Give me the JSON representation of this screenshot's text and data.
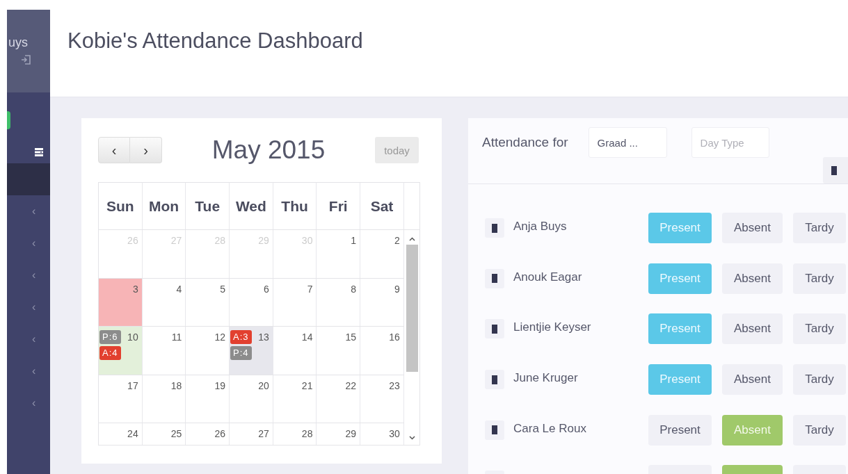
{
  "sidebar": {
    "user_name": "uys",
    "items": [
      {
        "kind": "badge"
      },
      {
        "kind": "menu"
      },
      {
        "kind": "nav",
        "selected": true
      },
      {
        "kind": "nav",
        "label": "‹",
        "selected": false
      },
      {
        "kind": "nav",
        "label": "‹",
        "selected": false
      },
      {
        "kind": "nav",
        "label": "‹",
        "selected": false
      },
      {
        "kind": "nav",
        "label": "‹",
        "selected": false
      },
      {
        "kind": "nav",
        "label": "‹",
        "selected": false
      },
      {
        "kind": "nav",
        "label": "‹",
        "selected": false
      },
      {
        "kind": "nav",
        "label": "‹",
        "selected": false
      }
    ]
  },
  "header": {
    "title": "Kobie's Attendance Dashboard"
  },
  "calendar": {
    "prev": "‹",
    "next": "›",
    "title": "May 2015",
    "today": "today",
    "weekdays": [
      "Sun",
      "Mon",
      "Tue",
      "Wed",
      "Thu",
      "Fri",
      "Sat"
    ],
    "weeks": [
      [
        {
          "day": "26",
          "other_month": true
        },
        {
          "day": "27",
          "other_month": true
        },
        {
          "day": "28",
          "other_month": true
        },
        {
          "day": "29",
          "other_month": true
        },
        {
          "day": "30",
          "other_month": true
        },
        {
          "day": "1",
          "other_month": false
        },
        {
          "day": "2",
          "other_month": false
        }
      ],
      [
        {
          "day": "3",
          "other_month": false,
          "color": "#f7b4b6"
        },
        {
          "day": "4",
          "other_month": false
        },
        {
          "day": "5",
          "other_month": false
        },
        {
          "day": "6",
          "other_month": false
        },
        {
          "day": "7",
          "other_month": false
        },
        {
          "day": "8",
          "other_month": false
        },
        {
          "day": "9",
          "other_month": false
        }
      ],
      [
        {
          "day": "10",
          "other_month": false,
          "color": "#e3f0da",
          "events": [
            {
              "label": "P:6",
              "color": "#8c8c8c"
            },
            {
              "label": "A:4",
              "color": "#e2402f"
            }
          ]
        },
        {
          "day": "11",
          "other_month": false
        },
        {
          "day": "12",
          "other_month": false
        },
        {
          "day": "13",
          "other_month": false,
          "color": "#e7e7ed",
          "events": [
            {
              "label": "A:3",
              "color": "#e2402f"
            },
            {
              "label": "P:4",
              "color": "#8c8c8c"
            }
          ]
        },
        {
          "day": "14",
          "other_month": false
        },
        {
          "day": "15",
          "other_month": false
        },
        {
          "day": "16",
          "other_month": false
        }
      ],
      [
        {
          "day": "17",
          "other_month": false
        },
        {
          "day": "18",
          "other_month": false
        },
        {
          "day": "19",
          "other_month": false
        },
        {
          "day": "20",
          "other_month": false
        },
        {
          "day": "21",
          "other_month": false
        },
        {
          "day": "22",
          "other_month": false
        },
        {
          "day": "23",
          "other_month": false
        }
      ],
      [
        {
          "day": "24",
          "other_month": false
        },
        {
          "day": "25",
          "other_month": false
        },
        {
          "day": "26",
          "other_month": false
        },
        {
          "day": "27",
          "other_month": false
        },
        {
          "day": "28",
          "other_month": false
        },
        {
          "day": "29",
          "other_month": false
        },
        {
          "day": "30",
          "other_month": false
        }
      ]
    ]
  },
  "attendance": {
    "label": "Attendance for",
    "class_field": {
      "value": "Graad ..."
    },
    "day_type_field": {
      "placeholder": "Day Type"
    },
    "students": [
      {
        "name": "Anja Buys",
        "buttons": [
          {
            "label": "Present",
            "kind": "present",
            "selected": true
          },
          {
            "label": "Absent",
            "kind": "absent",
            "selected": false
          },
          {
            "label": "Tardy",
            "kind": "tardy",
            "selected": false
          }
        ]
      },
      {
        "name": "Anouk Eagar",
        "buttons": [
          {
            "label": "Present",
            "kind": "present",
            "selected": true
          },
          {
            "label": "Absent",
            "kind": "absent",
            "selected": false
          },
          {
            "label": "Tardy",
            "kind": "tardy",
            "selected": false
          }
        ]
      },
      {
        "name": "Lientjie Keyser",
        "buttons": [
          {
            "label": "Present",
            "kind": "present",
            "selected": true
          },
          {
            "label": "Absent",
            "kind": "absent",
            "selected": false
          },
          {
            "label": "Tardy",
            "kind": "tardy",
            "selected": false
          }
        ]
      },
      {
        "name": "June Kruger",
        "buttons": [
          {
            "label": "Present",
            "kind": "present",
            "selected": true
          },
          {
            "label": "Absent",
            "kind": "absent",
            "selected": false
          },
          {
            "label": "Tardy",
            "kind": "tardy",
            "selected": false
          }
        ]
      },
      {
        "name": "Cara Le Roux",
        "buttons": [
          {
            "label": "Present",
            "kind": "present",
            "selected": false
          },
          {
            "label": "Absent",
            "kind": "absent",
            "selected": true
          },
          {
            "label": "Tardy",
            "kind": "tardy",
            "selected": false
          }
        ]
      },
      {
        "buttons": [
          {
            "kind": "present",
            "selected": false
          },
          {
            "kind": "absent",
            "selected": true
          },
          {
            "kind": "tardy",
            "selected": false
          }
        ]
      }
    ]
  }
}
